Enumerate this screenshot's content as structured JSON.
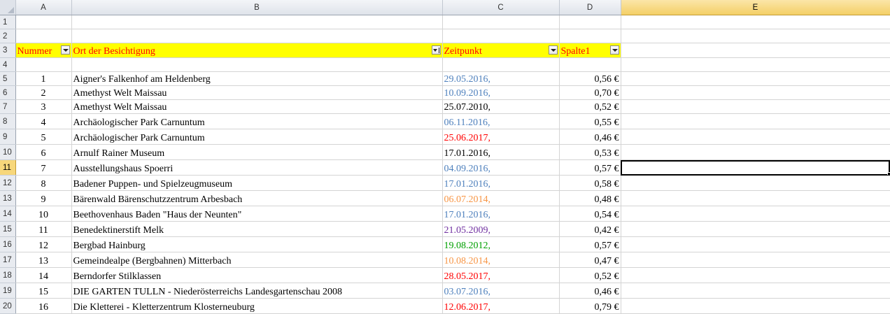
{
  "columns": [
    "A",
    "B",
    "C",
    "D",
    "E"
  ],
  "header": {
    "number": "Nummer",
    "place": "Ort der Besichtigung",
    "time": "Zeitpunkt",
    "price": "Spalte1"
  },
  "rows": [
    {
      "row": "5",
      "number": "1",
      "place": "Aigner's Falkenhof am Heldenberg",
      "date": "29.05.2016,",
      "date_color": "#4f81bd",
      "price": "0,56 €"
    },
    {
      "row": "6",
      "number": "2",
      "place": "Amethyst Welt Maissau",
      "date": "10.09.2016,",
      "date_color": "#4f81bd",
      "price": "0,70 €"
    },
    {
      "row": "7",
      "number": "3",
      "place": "Amethyst Welt Maissau",
      "date": "25.07.2010,",
      "date_color": "#000000",
      "price": "0,52 €"
    },
    {
      "row": "8",
      "number": "4",
      "place": "Archäologischer Park Carnuntum",
      "date": "06.11.2016,",
      "date_color": "#4f81bd",
      "price": "0,55 €"
    },
    {
      "row": "9",
      "number": "5",
      "place": "Archäologischer Park Carnuntum",
      "date": "25.06.2017,",
      "date_color": "#ff0000",
      "price": "0,46 €"
    },
    {
      "row": "10",
      "number": "6",
      "place": "Arnulf Rainer Museum",
      "date": "17.01.2016,",
      "date_color": "#000000",
      "price": "0,53 €"
    },
    {
      "row": "11",
      "number": "7",
      "place": "Ausstellungshaus Spoerri",
      "date": "04.09.2016,",
      "date_color": "#4f81bd",
      "price": "0,57 €"
    },
    {
      "row": "12",
      "number": "8",
      "place": "Badener Puppen- und Spielzeugmuseum",
      "date": "17.01.2016,",
      "date_color": "#4f81bd",
      "price": "0,58 €"
    },
    {
      "row": "13",
      "number": "9",
      "place": "Bärenwald Bärenschutzzentrum Arbesbach",
      "date": "06.07.2014,",
      "date_color": "#f79646",
      "price": "0,48 €"
    },
    {
      "row": "14",
      "number": "10",
      "place": "Beethovenhaus Baden \"Haus der Neunten\"",
      "date": "17.01.2016,",
      "date_color": "#4f81bd",
      "price": "0,54 €"
    },
    {
      "row": "15",
      "number": "11",
      "place": "Benedektinerstift Melk",
      "date": "21.05.2009,",
      "date_color": "#7030a0",
      "price": "0,42 €"
    },
    {
      "row": "16",
      "number": "12",
      "place": "Bergbad Hainburg",
      "date": "19.08.2012,",
      "date_color": "#00a000",
      "price": "0,57 €"
    },
    {
      "row": "17",
      "number": "13",
      "place": "Gemeindealpe (Bergbahnen) Mitterbach",
      "date": "10.08.2014,",
      "date_color": "#f79646",
      "price": "0,47 €"
    },
    {
      "row": "18",
      "number": "14",
      "place": "Berndorfer Stilklassen",
      "date": "28.05.2017,",
      "date_color": "#ff0000",
      "price": "0,52 €"
    },
    {
      "row": "19",
      "number": "15",
      "place": "DIE GARTEN TULLN - Niederösterreichs Landesgartenschau 2008",
      "date": "03.07.2016,",
      "date_color": "#4f81bd",
      "price": "0,46 €"
    },
    {
      "row": "20",
      "number": "16",
      "place": "Die Kletterei - Kletterzentrum Klosterneuburg",
      "date": "12.06.2017,",
      "date_color": "#ff0000",
      "price": "0,79 €"
    }
  ],
  "colors": {
    "header_fill": "#ffff00",
    "header_text": "#ff0000",
    "selection": "#f4cf66"
  }
}
